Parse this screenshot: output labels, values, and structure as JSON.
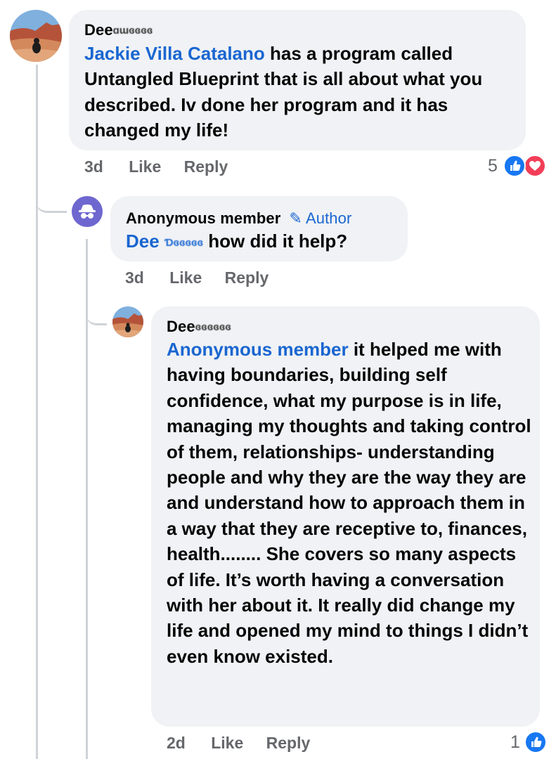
{
  "colors": {
    "link": "#1a66d1",
    "meta": "#65676b",
    "bubble": "#f0f2f5",
    "like": "#1877f2",
    "love": "#f33e58"
  },
  "comments": [
    {
      "author_first": "Dee",
      "author_rest": "ɑɯɞɞɞɞ",
      "mention": "Jackie Villa Catalano",
      "text": " has a program called Untangled Blueprint that is all about what you described.  Iv done her program and it has changed my life!",
      "time": "3d",
      "like_label": "Like",
      "reply_label": "Reply",
      "reaction_count": "5",
      "reactions": [
        "like-icon",
        "love-icon"
      ]
    },
    {
      "author": "Anonymous member",
      "badge": "Author",
      "mention_first": "Dee",
      "mention_rest": "Ɗɞɞɞɞɞ",
      "text": " how did it help?",
      "time": "3d",
      "like_label": "Like",
      "reply_label": "Reply"
    },
    {
      "author_first": "Dee",
      "author_rest": "ɞɞɞɞɞɞ",
      "mention": "Anonymous member",
      "text": " it helped me with having boundaries, building self confidence, what my purpose is in life, managing my thoughts and taking control of them, relationships- understanding people and why they are the way they are and understand how to approach them in a way that they are receptive to, finances, health........ She covers so many aspects of life.  It’s worth having a conversation with her about it.  It really did change my life and opened my mind to things I didn’t even know existed.",
      "time": "2d",
      "like_label": "Like",
      "reply_label": "Reply",
      "reaction_count": "1",
      "reactions": [
        "like-icon"
      ]
    }
  ]
}
